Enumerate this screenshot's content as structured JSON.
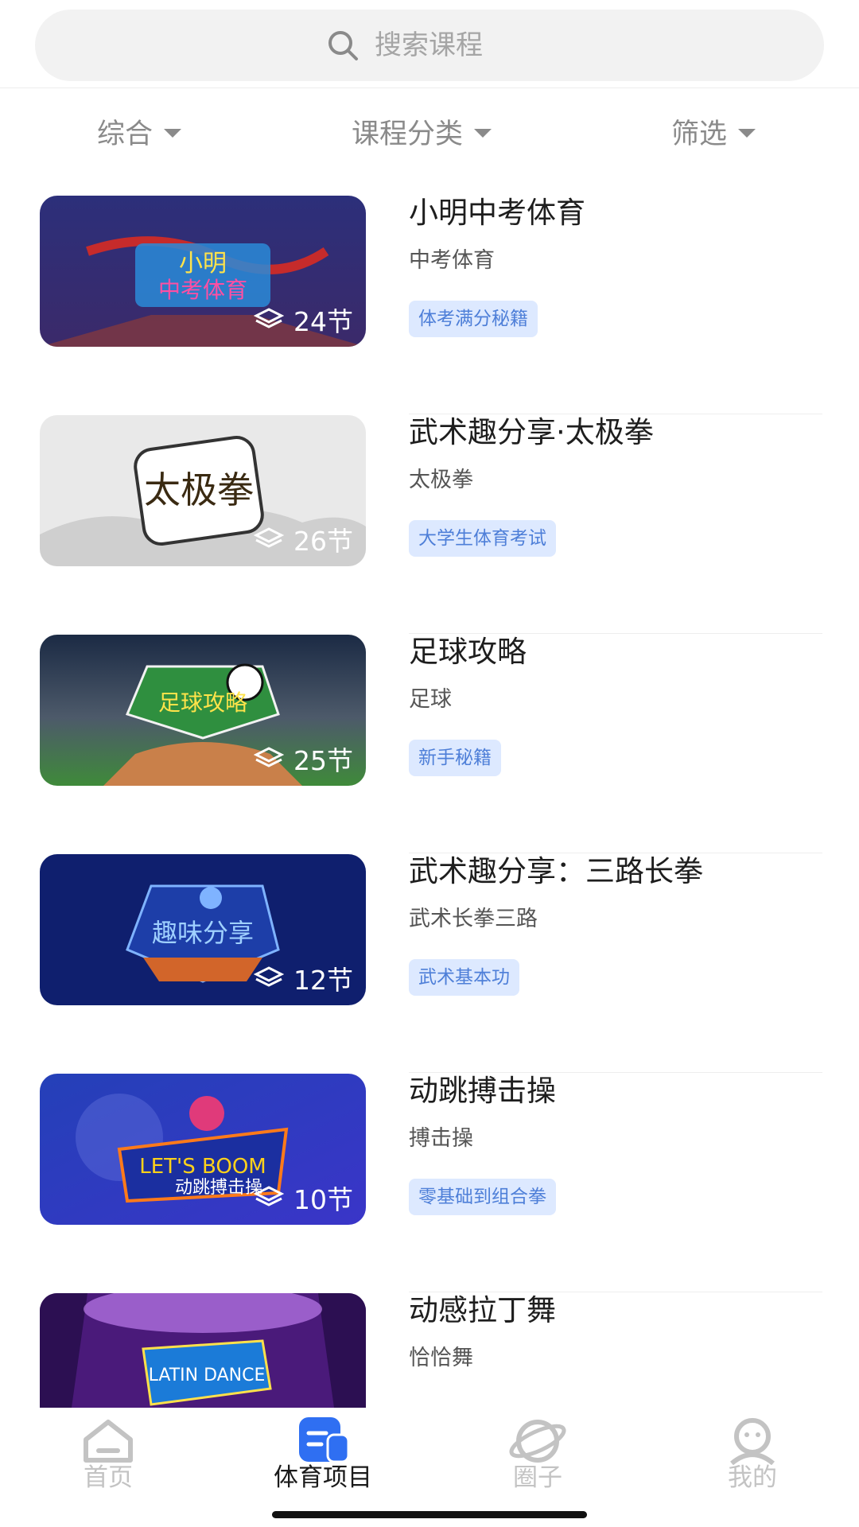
{
  "search": {
    "placeholder": "搜索课程"
  },
  "filters": [
    {
      "label": "综合"
    },
    {
      "label": "课程分类"
    },
    {
      "label": "筛选"
    }
  ],
  "courses": [
    {
      "title": "小明中考体育",
      "subtitle": "中考体育",
      "tag": "体考满分秘籍",
      "lessons": "24节",
      "cover_text": "小明 中考体育"
    },
    {
      "title": "武术趣分享·太极拳",
      "subtitle": "太极拳",
      "tag": "大学生体育考试",
      "lessons": "26节",
      "cover_text": "太极拳"
    },
    {
      "title": "足球攻略",
      "subtitle": "足球",
      "tag": "新手秘籍",
      "lessons": "25节",
      "cover_text": "足球攻略"
    },
    {
      "title": "武术趣分享：三路长拳",
      "subtitle": "武术长拳三路",
      "tag": "武术基本功",
      "lessons": "12节",
      "cover_text": "趣味分享"
    },
    {
      "title": "动跳搏击操",
      "subtitle": "搏击操",
      "tag": "零基础到组合拳",
      "lessons": "10节",
      "cover_text": "LET'S BOOM 动跳搏击操"
    },
    {
      "title": "动感拉丁舞",
      "subtitle": "恰恰舞",
      "tag": "",
      "lessons": "",
      "cover_text": "LATIN DANCE 动感拉丁"
    }
  ],
  "nav": [
    {
      "label": "首页",
      "icon": "home-icon",
      "active": false
    },
    {
      "label": "体育项目",
      "icon": "course-list-icon",
      "active": true
    },
    {
      "label": "圈子",
      "icon": "planet-icon",
      "active": false
    },
    {
      "label": "我的",
      "icon": "profile-icon",
      "active": false
    }
  ],
  "colors": {
    "accent": "#2f6ff2",
    "tag_bg": "#dde9ff",
    "tag_text": "#4e7fd8",
    "inactive": "#c3c3c3"
  }
}
